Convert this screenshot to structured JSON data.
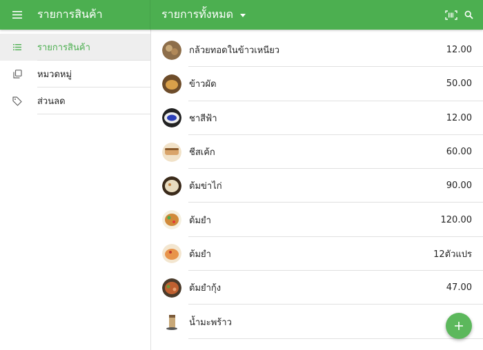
{
  "appbar": {
    "app_title": "รายการสินค้า",
    "list_title": "รายการทั้งหมด"
  },
  "sidebar": {
    "items": [
      {
        "label": "รายการสินค้า",
        "icon": "list-icon",
        "active": true
      },
      {
        "label": "หมวดหมู่",
        "icon": "copy-icon",
        "active": false
      },
      {
        "label": "ส่วนลด",
        "icon": "tag-icon",
        "active": false
      }
    ]
  },
  "products": [
    {
      "name": "กล้วยทอดในข้าวเหนียว",
      "price": "12.00",
      "thumb_color": "#8d6e4a"
    },
    {
      "name": "ข้าวผัด",
      "price": "50.00",
      "thumb_color": "#b07a3a"
    },
    {
      "name": "ชาสีฟ้า",
      "price": "12.00",
      "thumb_color": "#3f51b5"
    },
    {
      "name": "ชีสเค้ก",
      "price": "60.00",
      "thumb_color": "#d9a46a"
    },
    {
      "name": "ต้มข่าไก่",
      "price": "90.00",
      "thumb_color": "#c9b590"
    },
    {
      "name": "ต้มยำ",
      "price": "120.00",
      "thumb_color": "#c98a3a"
    },
    {
      "name": "ต้มยำ",
      "price": "12ตัวแปร",
      "thumb_color": "#e0a060"
    },
    {
      "name": "ต้มยำกุ้ง",
      "price": "47.00",
      "thumb_color": "#7a5a3a"
    },
    {
      "name": "น้ำมะพร้าว",
      "price": "",
      "thumb_color": "#a08060"
    }
  ],
  "colors": {
    "primary": "#4caf50",
    "fab": "#5cb85c"
  },
  "icons": [
    "menu-icon",
    "dropdown-icon",
    "barcode-icon",
    "search-icon",
    "plus-icon"
  ]
}
